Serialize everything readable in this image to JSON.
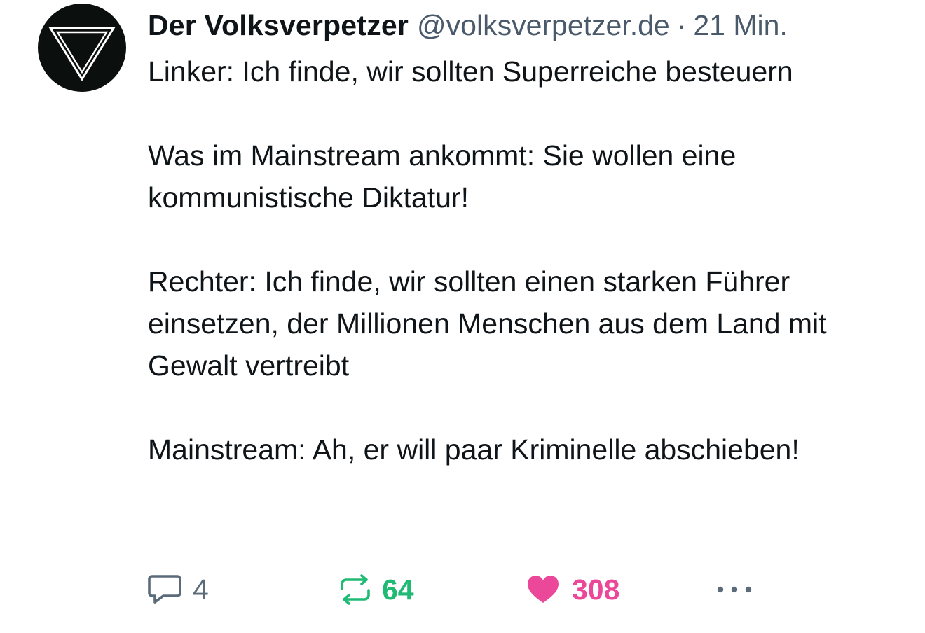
{
  "post": {
    "author": {
      "display_name": "Der Volksverpetzer",
      "handle": "@volksverpetzer.de",
      "avatar_icon": "inverted-triangle-logo"
    },
    "separator": "·",
    "time": "21 Min.",
    "paragraphs": [
      "Linker: Ich finde, wir sollten Superreiche besteuern",
      "Was im Mainstream ankommt: Sie wollen eine kommunistische Diktatur!",
      "Rechter: Ich finde, wir sollten einen starken Führer einsetzen, der Millionen Menschen aus dem Land mit Gewalt vertreibt",
      "Mainstream: Ah, er will paar Kriminelle abschieben!"
    ],
    "actions": {
      "reply": {
        "icon": "comment-icon",
        "count": "4",
        "color": "#5b6b7a"
      },
      "repost": {
        "icon": "repost-icon",
        "count": "64",
        "color": "#1fba74"
      },
      "like": {
        "icon": "heart-icon",
        "count": "308",
        "color": "#ec4899"
      },
      "more": {
        "icon": "more-dots-icon"
      }
    }
  }
}
